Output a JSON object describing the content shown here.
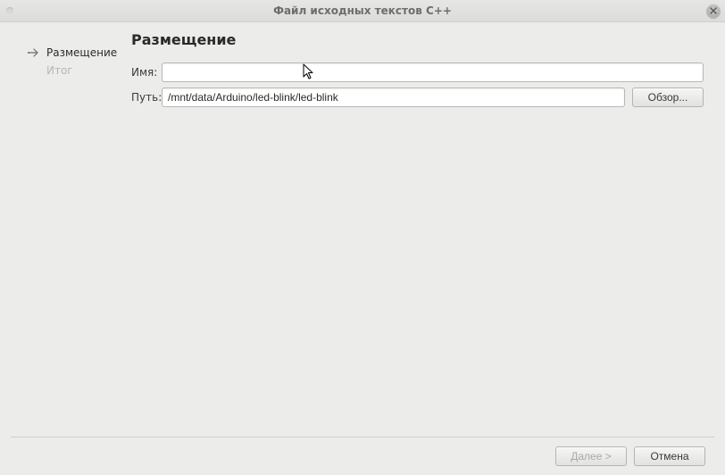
{
  "window": {
    "title": "Файл исходных текстов C++"
  },
  "steps": {
    "items": [
      {
        "label": "Размещение",
        "active": true
      },
      {
        "label": "Итог",
        "active": false
      }
    ]
  },
  "page": {
    "heading": "Размещение",
    "name_label": "Имя:",
    "name_value": "",
    "path_label": "Путь:",
    "path_value": "/mnt/data/Arduino/led-blink/led-blink",
    "browse_label": "Обзор..."
  },
  "buttons": {
    "next_label": "Далее >",
    "cancel_label": "Отмена"
  }
}
